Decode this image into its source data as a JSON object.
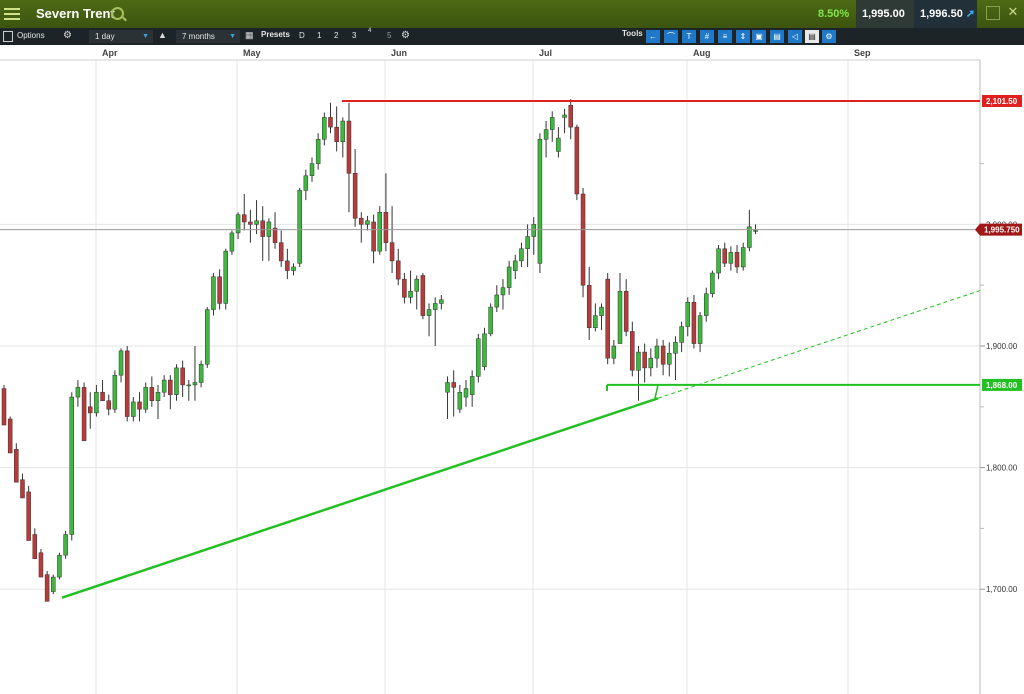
{
  "header": {
    "title": "Severn Trent",
    "change": "8.50%",
    "sell": "1,995.00",
    "buy": "1,996.50"
  },
  "toolbar": {
    "options_label": "Options",
    "interval": "1 day",
    "range": "7 months",
    "presets_label": "Presets",
    "presets": [
      "D",
      "1",
      "2",
      "3",
      "4",
      "5"
    ],
    "tools_label": "Tools"
  },
  "icons": {
    "menu": "menu-icon",
    "search": "search-icon",
    "settings": "gear-icon"
  },
  "colors": {
    "up": "#3cb83c",
    "down": "#b83a3a",
    "resistance": "#e02020",
    "support": "#22c022",
    "header_bg": "#4e6a14",
    "toolbar_bg": "#1c2428"
  },
  "chart_data": {
    "type": "candlestick",
    "x_tick_labels": [
      "Apr",
      "May",
      "Jun",
      "Jul",
      "Aug",
      "Sep"
    ],
    "y_tick_labels": [
      "1,700.00",
      "1,800.00",
      "1,900.00",
      "2,000.00"
    ],
    "ylim": [
      1640,
      2145
    ],
    "grid": true,
    "candles": [
      [
        1865,
        1868,
        1840,
        1835
      ],
      [
        1840,
        1842,
        1815,
        1812
      ],
      [
        1815,
        1820,
        1790,
        1788
      ],
      [
        1790,
        1795,
        1780,
        1775
      ],
      [
        1780,
        1785,
        1745,
        1740
      ],
      [
        1745,
        1750,
        1730,
        1725
      ],
      [
        1730,
        1733,
        1712,
        1710
      ],
      [
        1712,
        1715,
        1695,
        1690
      ],
      [
        1698,
        1712,
        1696,
        1710
      ],
      [
        1710,
        1730,
        1708,
        1728
      ],
      [
        1728,
        1748,
        1725,
        1745
      ],
      [
        1745,
        1862,
        1740,
        1858
      ],
      [
        1858,
        1872,
        1850,
        1866
      ],
      [
        1866,
        1870,
        1825,
        1822
      ],
      [
        1850,
        1862,
        1832,
        1845
      ],
      [
        1845,
        1868,
        1842,
        1862
      ],
      [
        1862,
        1872,
        1855,
        1855
      ],
      [
        1855,
        1860,
        1843,
        1848
      ],
      [
        1848,
        1880,
        1845,
        1876
      ],
      [
        1876,
        1898,
        1870,
        1896
      ],
      [
        1896,
        1900,
        1838,
        1842
      ],
      [
        1842,
        1858,
        1838,
        1854
      ],
      [
        1854,
        1862,
        1838,
        1848
      ],
      [
        1848,
        1870,
        1845,
        1866
      ],
      [
        1866,
        1875,
        1850,
        1855
      ],
      [
        1855,
        1868,
        1840,
        1862
      ],
      [
        1862,
        1876,
        1858,
        1872
      ],
      [
        1872,
        1876,
        1848,
        1860
      ],
      [
        1860,
        1885,
        1855,
        1882
      ],
      [
        1882,
        1888,
        1858,
        1868
      ],
      [
        1868,
        1872,
        1855,
        1868
      ],
      [
        1868,
        1900,
        1855,
        1870
      ],
      [
        1870,
        1888,
        1866,
        1885
      ],
      [
        1885,
        1932,
        1882,
        1930
      ],
      [
        1930,
        1960,
        1925,
        1957
      ],
      [
        1957,
        1963,
        1930,
        1935
      ],
      [
        1935,
        1980,
        1930,
        1978
      ],
      [
        1978,
        1995,
        1975,
        1993
      ],
      [
        1993,
        2010,
        1988,
        2008
      ],
      [
        2008,
        2025,
        1995,
        2002
      ],
      [
        2002,
        2012,
        1985,
        2000
      ],
      [
        2000,
        2020,
        1992,
        2003
      ],
      [
        2003,
        2015,
        1970,
        1990
      ],
      [
        1990,
        2005,
        1970,
        2002
      ],
      [
        1997,
        2010,
        1980,
        1985
      ],
      [
        1985,
        1995,
        1965,
        1970
      ],
      [
        1970,
        1980,
        1955,
        1962
      ],
      [
        1962,
        1968,
        1958,
        1965
      ],
      [
        1968,
        2030,
        1965,
        2028
      ],
      [
        2028,
        2045,
        2020,
        2040
      ],
      [
        2040,
        2055,
        2035,
        2050
      ],
      [
        2050,
        2075,
        2045,
        2070
      ],
      [
        2070,
        2092,
        2065,
        2088
      ],
      [
        2088,
        2100,
        2075,
        2080
      ],
      [
        2080,
        2097,
        2060,
        2068
      ],
      [
        2068,
        2088,
        2055,
        2085
      ],
      [
        2085,
        2100,
        2010,
        2042
      ],
      [
        2042,
        2062,
        1998,
        2005
      ],
      [
        2005,
        2010,
        1985,
        2000
      ],
      [
        2000,
        2007,
        1995,
        2003
      ],
      [
        2002,
        2008,
        1968,
        1978
      ],
      [
        1978,
        2015,
        1975,
        2010
      ],
      [
        2010,
        2042,
        1978,
        1985
      ],
      [
        1985,
        2015,
        1960,
        1970
      ],
      [
        1970,
        1980,
        1950,
        1955
      ],
      [
        1955,
        1960,
        1935,
        1940
      ],
      [
        1940,
        1962,
        1935,
        1945
      ],
      [
        1945,
        1958,
        1930,
        1955
      ],
      [
        1958,
        1960,
        1922,
        1925
      ],
      [
        1925,
        1935,
        1908,
        1930
      ],
      [
        1930,
        1940,
        1900,
        1935
      ],
      [
        1935,
        1942,
        1930,
        1938
      ],
      [
        1862,
        1875,
        1840,
        1870
      ],
      [
        1870,
        1880,
        1842,
        1866
      ],
      [
        1848,
        1868,
        1845,
        1862
      ],
      [
        1858,
        1872,
        1850,
        1865
      ],
      [
        1860,
        1880,
        1850,
        1875
      ],
      [
        1875,
        1910,
        1870,
        1906
      ],
      [
        1883,
        1915,
        1880,
        1910
      ],
      [
        1910,
        1935,
        1908,
        1932
      ],
      [
        1932,
        1950,
        1928,
        1942
      ],
      [
        1942,
        1955,
        1930,
        1948
      ],
      [
        1948,
        1970,
        1942,
        1965
      ],
      [
        1962,
        1975,
        1955,
        1970
      ],
      [
        1970,
        1985,
        1965,
        1980
      ],
      [
        1980,
        2000,
        1965,
        1990
      ],
      [
        1990,
        2006,
        1975,
        2000
      ],
      [
        1968,
        2075,
        1960,
        2070
      ],
      [
        2070,
        2085,
        2055,
        2078
      ],
      [
        2078,
        2093,
        2068,
        2088
      ],
      [
        2060,
        2080,
        2055,
        2071
      ],
      [
        2088,
        2095,
        2075,
        2090
      ],
      [
        2098,
        2103,
        2070,
        2080
      ],
      [
        2080,
        2082,
        2020,
        2025
      ],
      [
        2025,
        2030,
        1940,
        1950
      ],
      [
        1950,
        1965,
        1905,
        1915
      ],
      [
        1915,
        1935,
        1912,
        1925
      ],
      [
        1925,
        1935,
        1913,
        1932
      ],
      [
        1955,
        1960,
        1885,
        1890
      ],
      [
        1890,
        1905,
        1885,
        1900
      ],
      [
        1902,
        1960,
        1925,
        1945
      ],
      [
        1945,
        1955,
        1908,
        1912
      ],
      [
        1912,
        1920,
        1875,
        1880
      ],
      [
        1880,
        1900,
        1855,
        1895
      ],
      [
        1895,
        1902,
        1870,
        1882
      ],
      [
        1882,
        1898,
        1875,
        1890
      ],
      [
        1890,
        1906,
        1882,
        1900
      ],
      [
        1900,
        1905,
        1876,
        1885
      ],
      [
        1885,
        1903,
        1875,
        1894
      ],
      [
        1894,
        1908,
        1872,
        1903
      ],
      [
        1903,
        1920,
        1895,
        1916
      ],
      [
        1916,
        1940,
        1908,
        1936
      ],
      [
        1936,
        1942,
        1898,
        1902
      ],
      [
        1902,
        1928,
        1895,
        1925
      ],
      [
        1925,
        1948,
        1920,
        1943
      ],
      [
        1943,
        1962,
        1940,
        1960
      ],
      [
        1960,
        1983,
        1955,
        1980
      ],
      [
        1980,
        1985,
        1965,
        1968
      ],
      [
        1968,
        1982,
        1962,
        1977
      ],
      [
        1977,
        1983,
        1960,
        1965
      ],
      [
        1965,
        1985,
        1962,
        1981
      ],
      [
        1981,
        2012,
        1978,
        1998
      ],
      [
        1995,
        2000,
        1992,
        1995
      ]
    ],
    "hlines": [
      {
        "label": "2,101.50",
        "value": 2101.5
      },
      {
        "label": "1,868.00",
        "value": 1868
      },
      {
        "label": "1,995.750",
        "value": 1995.75
      }
    ],
    "trendline": {
      "from": 1693,
      "to": 1857
    }
  }
}
